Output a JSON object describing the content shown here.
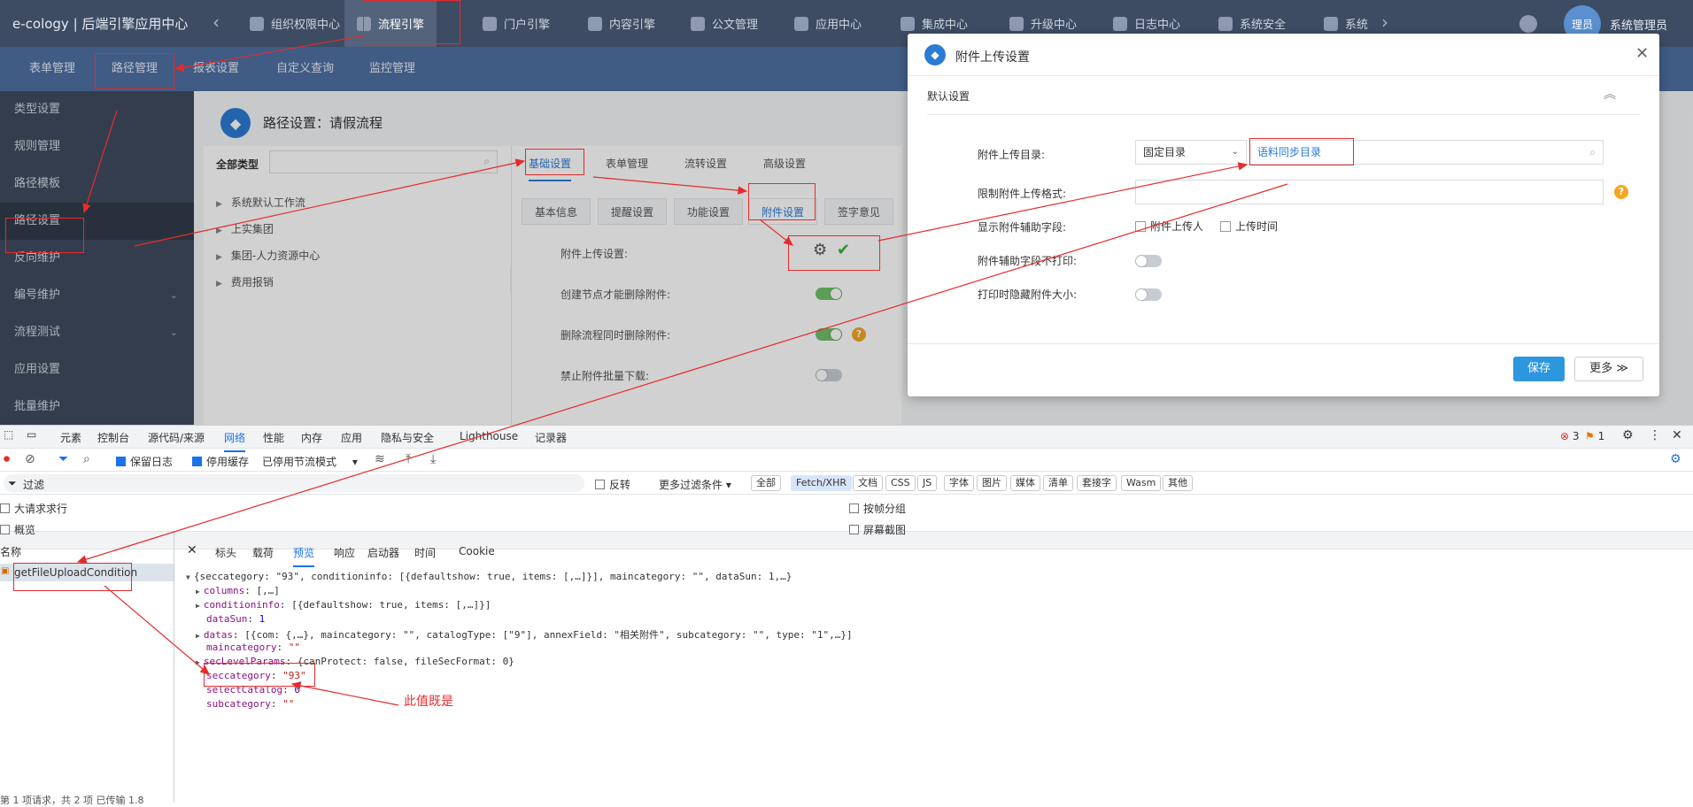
{
  "app": {
    "title": "e-cology | 后端引擎应用中心"
  },
  "topnav": {
    "modules": [
      {
        "label": "组织权限中心",
        "active": false
      },
      {
        "label": "流程引擎",
        "active": true
      },
      {
        "label": "门户引擎",
        "active": false
      },
      {
        "label": "内容引擎",
        "active": false
      },
      {
        "label": "公文管理",
        "active": false
      },
      {
        "label": "应用中心",
        "active": false
      },
      {
        "label": "集成中心",
        "active": false
      },
      {
        "label": "升级中心",
        "active": false
      },
      {
        "label": "日志中心",
        "active": false
      },
      {
        "label": "系统安全",
        "active": false
      },
      {
        "label": "系统",
        "active": false
      }
    ],
    "avatar_text": "理员",
    "user_name": "系统管理员"
  },
  "subnav": {
    "tabs": [
      "表单管理",
      "路径管理",
      "报表设置",
      "自定义查询",
      "监控管理"
    ],
    "active": "路径管理"
  },
  "sidebar": {
    "items": [
      {
        "label": "类型设置",
        "chevron": false
      },
      {
        "label": "规则管理",
        "chevron": false
      },
      {
        "label": "路径模板",
        "chevron": false
      },
      {
        "label": "路径设置",
        "chevron": false,
        "active": true
      },
      {
        "label": "反向维护",
        "chevron": false
      },
      {
        "label": "编号维护",
        "chevron": true
      },
      {
        "label": "流程测试",
        "chevron": true
      },
      {
        "label": "应用设置",
        "chevron": false
      },
      {
        "label": "批量维护",
        "chevron": false
      }
    ]
  },
  "main": {
    "path_title": "路径设置：请假流程",
    "tree_label": "全部类型",
    "tree_items": [
      "系统默认工作流",
      "上实集团",
      "集团-人力资源中心",
      "费用报销"
    ],
    "tabs": [
      "基础设置",
      "表单管理",
      "流转设置",
      "高级设置"
    ],
    "active_tab": "基础设置",
    "subtabs": [
      "基本信息",
      "提醒设置",
      "功能设置",
      "附件设置",
      "签字意见"
    ],
    "active_subtab": "附件设置",
    "settings": [
      {
        "label": "附件上传设置:",
        "kind": "gear-check"
      },
      {
        "label": "创建节点才能删除附件:",
        "kind": "toggle",
        "on": true
      },
      {
        "label": "删除流程同时删除附件:",
        "kind": "toggle",
        "on": true,
        "help": true
      },
      {
        "label": "禁止附件批量下载:",
        "kind": "toggle",
        "on": false
      }
    ]
  },
  "modal": {
    "title": "附件上传设置",
    "section": "默认设置",
    "fields": {
      "dir_label": "附件上传目录:",
      "dir_select": "固定目录",
      "dir_value": "语料同步目录",
      "format_label": "限制附件上传格式:",
      "aux_label": "显示附件辅助字段:",
      "aux_options": [
        "附件上传人",
        "上传时间"
      ],
      "noprint_label": "附件辅助字段不打印:",
      "hidesize_label": "打印时隐藏附件大小:"
    },
    "save": "保存",
    "more": "更多"
  },
  "devtools": {
    "tabs": [
      "元素",
      "控制台",
      "源代码/来源",
      "网络",
      "性能",
      "内存",
      "应用",
      "隐私与安全",
      "Lighthouse",
      "记录器"
    ],
    "active_tab": "网络",
    "errors": "3",
    "warnings": "1",
    "toolbar": {
      "preserve_log": "保留日志",
      "disable_cache": "停用缓存",
      "throttle": "已停用节流模式"
    },
    "filter": {
      "placeholder": "过滤",
      "invert": "反转",
      "more": "更多过滤条件",
      "types": [
        "全部",
        "Fetch/XHR",
        "文档",
        "CSS",
        "JS",
        "字体",
        "图片",
        "媒体",
        "清单",
        "套接字",
        "Wasm",
        "其他"
      ],
      "active_type": "Fetch/XHR"
    },
    "options": {
      "large_rows": "大请求求行",
      "overview": "概览",
      "group_by_frame": "按帧分组",
      "screenshots": "屏幕截图"
    },
    "name_header": "名称",
    "request": "getFileUploadCondition",
    "detail_tabs": [
      "标头",
      "载荷",
      "预览",
      "响应",
      "启动器",
      "时间",
      "Cookie"
    ],
    "active_detail_tab": "预览",
    "preview": {
      "summary": "{seccategory: \"93\", conditioninfo: [{defaultshow: true, items: [,…]}], maincategory: \"\", dataSun: 1,…}",
      "lines": [
        {
          "expand": true,
          "key": "columns",
          "value": "[,…]"
        },
        {
          "expand": true,
          "key": "conditioninfo",
          "value": "[{defaultshow: true, items: [,…]}]"
        },
        {
          "expand": false,
          "key": "dataSun",
          "value": "1"
        },
        {
          "expand": true,
          "key": "datas",
          "value": "[{com: {,…}, maincategory: \"\", catalogType: [\"9\"], annexField: \"相关附件\", subcategory: \"\", type: \"1\",…}]"
        },
        {
          "expand": false,
          "key": "maincategory",
          "value": "\"\""
        },
        {
          "expand": true,
          "key": "secLevelParams",
          "value": "{canProtect: false, fileSecFormat: 0}"
        },
        {
          "expand": false,
          "key": "seccategory",
          "value": "\"93\""
        },
        {
          "expand": false,
          "key": "selectCatalog",
          "value": "0"
        },
        {
          "expand": false,
          "key": "subcategory",
          "value": "\"\""
        }
      ]
    },
    "status": "第 1 项请求，共 2 项    已传输 1.8"
  },
  "annotation": {
    "text": "此值既是"
  }
}
